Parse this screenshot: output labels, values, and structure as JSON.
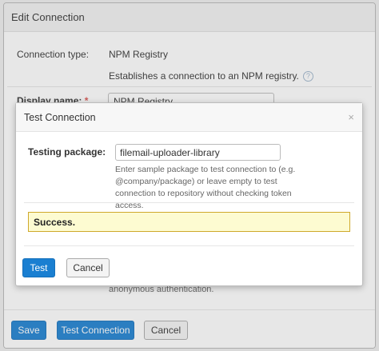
{
  "outer": {
    "title": "Edit Connection",
    "connection_type_label": "Connection type:",
    "connection_type_value": "NPM Registry",
    "connection_description": "Establishes a connection to an NPM registry.",
    "help_glyph": "?",
    "display_name_label": "Display name:",
    "required_mark": "*",
    "display_name_value": "NPM Registry",
    "anon_text": "anonymous authentication.",
    "save_label": "Save",
    "test_connection_label": "Test Connection",
    "cancel_label": "Cancel"
  },
  "inner": {
    "title": "Test Connection",
    "close_glyph": "×",
    "testing_package_label": "Testing package:",
    "testing_package_value": "filemail-uploader-library",
    "testing_package_help": "Enter sample package to test connection to (e.g. @company/package) or leave empty to test connection to repository without checking token access.",
    "success_text": "Success.",
    "test_label": "Test",
    "cancel_label": "Cancel"
  },
  "colors": {
    "primary": "#1a7fd1",
    "success_bg": "#fdfbd1",
    "success_border": "#cfa92c",
    "required": "#d9534f"
  }
}
